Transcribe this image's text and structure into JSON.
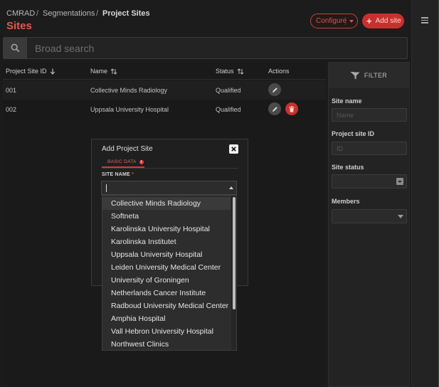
{
  "breadcrumb": {
    "root": "CMRAD",
    "separator": "/",
    "mid": "Segmentations",
    "current": "Project Sites"
  },
  "page": {
    "title": "Sites"
  },
  "header": {
    "configure_label": "Configure",
    "add_label": "Add site"
  },
  "search": {
    "placeholder": "Broad search"
  },
  "table": {
    "columns": {
      "id": "Project Site ID",
      "name": "Name",
      "status": "Status",
      "actions": "Actions"
    },
    "rows": [
      {
        "id": "001",
        "name": "Collective Minds Radiology",
        "status": "Qualified"
      },
      {
        "id": "002",
        "name": "Uppsala University Hospital",
        "status": "Qualified"
      }
    ]
  },
  "filter": {
    "title": "FILTER",
    "site_name_label": "Site name",
    "site_name_placeholder": "Name",
    "project_site_id_label": "Project site ID",
    "project_site_id_placeholder": "ID",
    "site_status_label": "Site status",
    "members_label": "Members"
  },
  "modal": {
    "title": "Add Project Site",
    "tab_label": "BASIC DATA",
    "tab_badge": "!",
    "field_label": "SITE NAME",
    "required_mark": "*",
    "options": [
      "Collective Minds Radiology",
      "Softneta",
      "Karolinska University Hospital",
      "Karolinska Institutet",
      "Uppsala University Hospital",
      "Leiden University Medical Center",
      "University of Groningen",
      "Netherlands Cancer Institute",
      "Radboud University Medical Center",
      "Amphia Hospital",
      "Vall Hebron University Hospital",
      "Northwest Clinics"
    ]
  },
  "colors": {
    "accent": "#c9302c",
    "title": "#e5594f",
    "background": "#1b1b1b"
  }
}
